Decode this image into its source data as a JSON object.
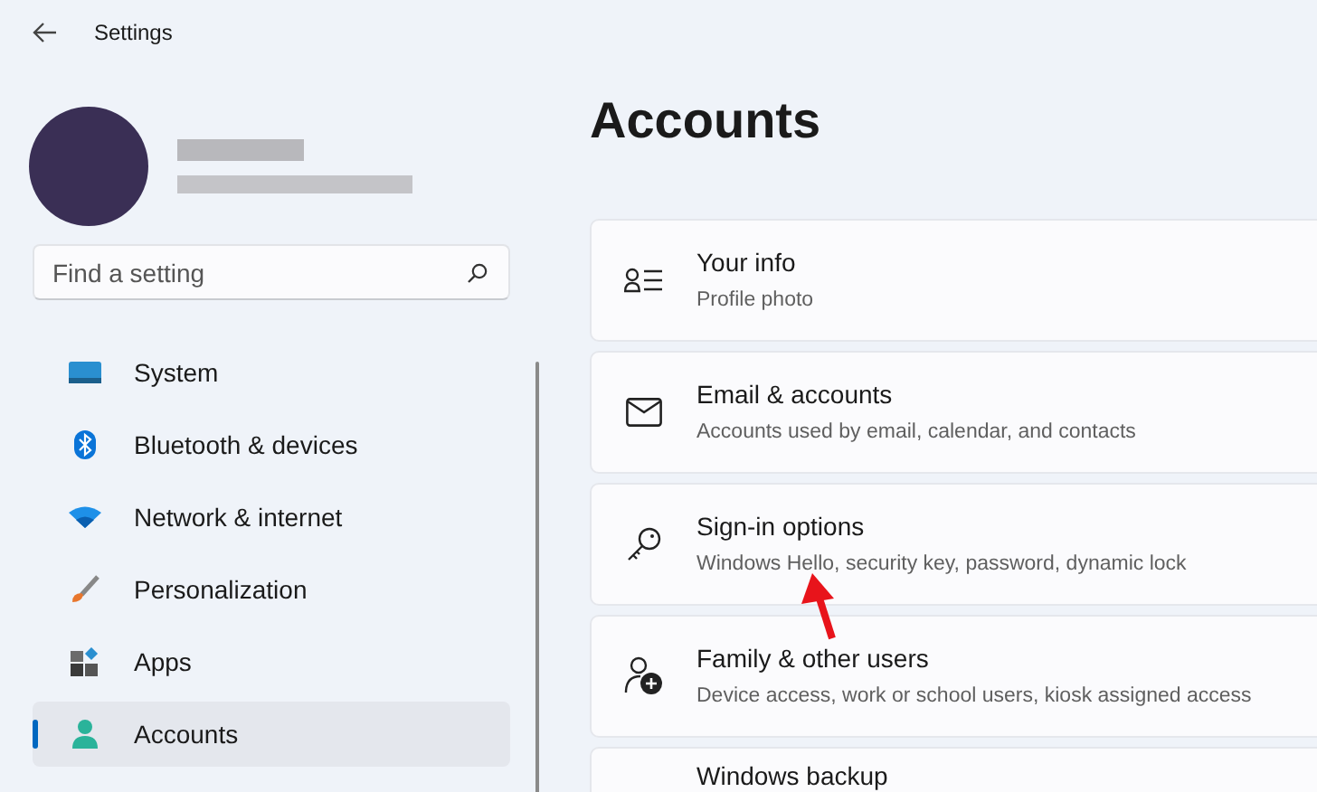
{
  "window": {
    "title": "Settings"
  },
  "search": {
    "placeholder": "Find a setting"
  },
  "sidebar": {
    "items": [
      {
        "label": "System",
        "kind": "system",
        "selected": false
      },
      {
        "label": "Bluetooth & devices",
        "kind": "bluetooth",
        "selected": false
      },
      {
        "label": "Network & internet",
        "kind": "network",
        "selected": false
      },
      {
        "label": "Personalization",
        "kind": "personalization",
        "selected": false
      },
      {
        "label": "Apps",
        "kind": "apps",
        "selected": false
      },
      {
        "label": "Accounts",
        "kind": "accounts",
        "selected": true
      }
    ]
  },
  "page": {
    "title": "Accounts",
    "cards": [
      {
        "title": "Your info",
        "subtitle": "Profile photo",
        "kind": "info"
      },
      {
        "title": "Email & accounts",
        "subtitle": "Accounts used by email, calendar, and contacts",
        "kind": "email"
      },
      {
        "title": "Sign-in options",
        "subtitle": "Windows Hello, security key, password, dynamic lock",
        "kind": "key"
      },
      {
        "title": "Family & other users",
        "subtitle": "Device access, work or school users, kiosk assigned access",
        "kind": "family"
      },
      {
        "title": "Windows backup",
        "kind": "none"
      }
    ]
  }
}
